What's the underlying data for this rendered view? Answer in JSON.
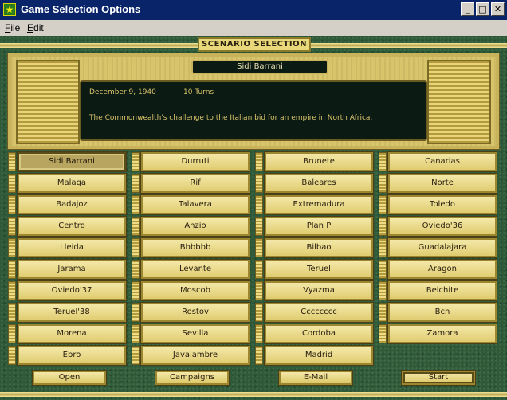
{
  "window": {
    "title": "Game Selection Options",
    "minimize": "_",
    "maximize": "□",
    "close": "✕"
  },
  "menu": [
    "File",
    "Edit"
  ],
  "header": {
    "section_label": "SCENARIO SELECTION"
  },
  "scenario": {
    "name": "Sidi Barrani",
    "date": "December 9, 1940",
    "turns": "10 Turns",
    "description": "The Commonwealth's challenge to the Italian bid for an empire in North Africa."
  },
  "scenario_columns": [
    [
      "Sidi Barrani",
      "Malaga",
      "Badajoz",
      "Centro",
      "Lleida",
      "Jarama",
      "Oviedo'37",
      "Teruel'38",
      "Morena",
      "Ebro"
    ],
    [
      "Durruti",
      "Rif",
      "Talavera",
      "Anzio",
      "Bbbbbb",
      "Levante",
      "Moscob",
      "Rostov",
      "Sevilla",
      "Javalambre"
    ],
    [
      "Brunete",
      "Baleares",
      "Extremadura",
      "Plan P",
      "Bilbao",
      "Teruel",
      "Vyazma",
      "Cccccccc",
      "Cordoba",
      "Madrid"
    ],
    [
      "Canarias",
      "Norte",
      "Toledo",
      "Oviedo'36",
      "Guadalajara",
      "Aragon",
      "Belchite",
      "Bcn",
      "Zamora"
    ]
  ],
  "selected_scenario": "Sidi Barrani",
  "actions": {
    "open": "Open",
    "campaigns": "Campaigns",
    "email": "E-Mail",
    "start": "Start"
  },
  "colors": {
    "felt": "#2f5a3a",
    "gold": "#e0cc70",
    "titlebar": "#0a246a"
  },
  "icons": {
    "app": "star-icon"
  }
}
